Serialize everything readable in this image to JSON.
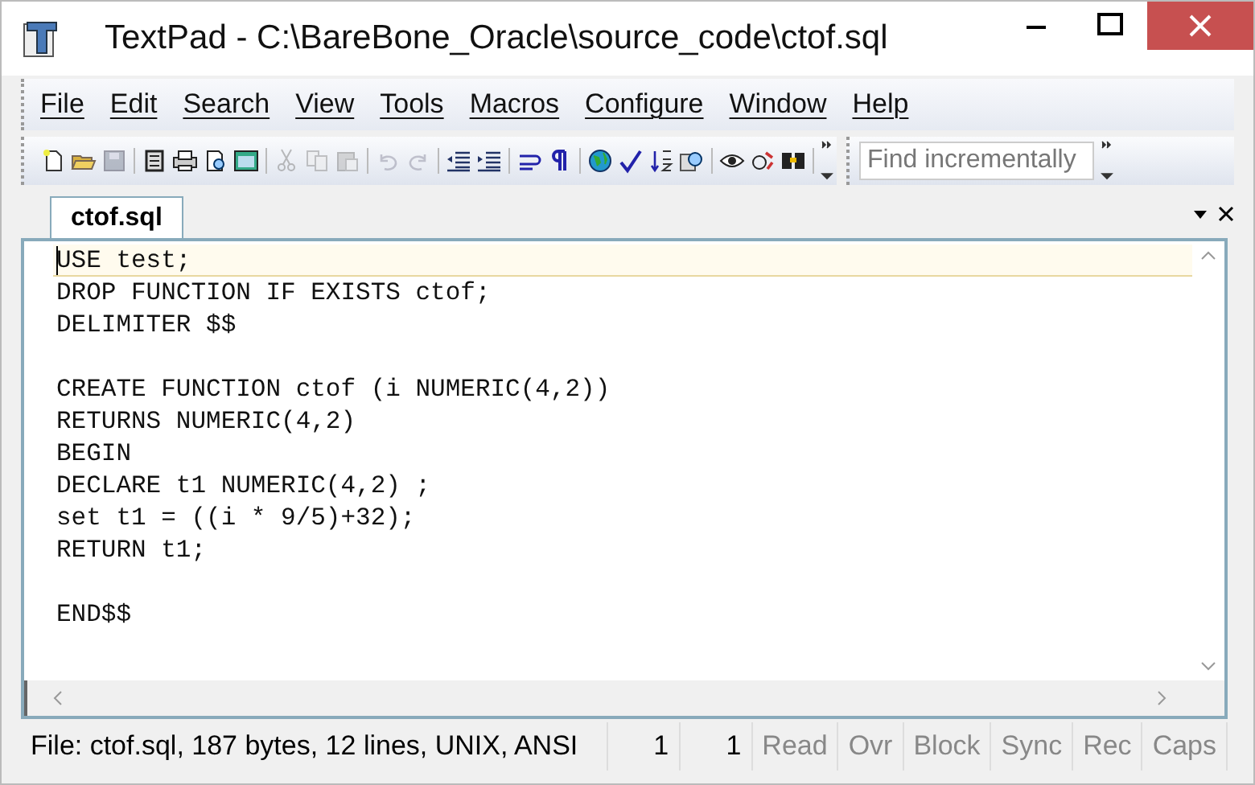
{
  "window": {
    "title": "TextPad - C:\\BareBone_Oracle\\source_code\\ctof.sql"
  },
  "menu": [
    "File",
    "Edit",
    "Search",
    "View",
    "Tools",
    "Macros",
    "Configure",
    "Window",
    "Help"
  ],
  "toolbar": {
    "groups": [
      [
        {
          "disabled": false
        },
        {
          "disabled": false
        },
        {
          "disabled": true
        }
      ],
      [
        {
          "disabled": false
        },
        {
          "disabled": false
        },
        {
          "disabled": false
        },
        {
          "disabled": false
        }
      ],
      [
        {
          "disabled": true
        },
        {
          "disabled": true
        },
        {
          "disabled": true
        }
      ],
      [
        {
          "disabled": true
        },
        {
          "disabled": true
        }
      ],
      [
        {
          "disabled": false
        },
        {
          "disabled": false
        }
      ],
      [
        {
          "disabled": false
        },
        {
          "disabled": false
        }
      ],
      [
        {
          "disabled": false
        },
        {
          "disabled": false
        },
        {
          "disabled": false
        },
        {
          "disabled": false
        }
      ],
      [
        {
          "disabled": false
        },
        {
          "disabled": false
        },
        {
          "disabled": false
        }
      ]
    ],
    "search": {
      "placeholder": "Find incrementally"
    }
  },
  "tabs": [
    {
      "label": "ctof.sql",
      "selected": true
    }
  ],
  "editor": {
    "text": "USE test;\nDROP FUNCTION IF EXISTS ctof;\nDELIMITER $$\n\nCREATE FUNCTION ctof (i NUMERIC(4,2))\nRETURNS NUMERIC(4,2)\nBEGIN\nDECLARE t1 NUMERIC(4,2) ;\nset t1 = ((i * 9/5)+32);\nRETURN t1;\n\nEND$$"
  },
  "status_bar": {
    "info": "File: ctof.sql, 187 bytes, 12 lines, UNIX, ANSI",
    "line": "1",
    "column": "1",
    "indicators": [
      {
        "label": "Read",
        "disabled": true
      },
      {
        "label": "Ovr",
        "disabled": true
      },
      {
        "label": "Block",
        "disabled": true
      },
      {
        "label": "Sync",
        "disabled": true
      },
      {
        "label": "Rec",
        "disabled": true
      },
      {
        "label": "Caps",
        "disabled": true
      }
    ]
  }
}
